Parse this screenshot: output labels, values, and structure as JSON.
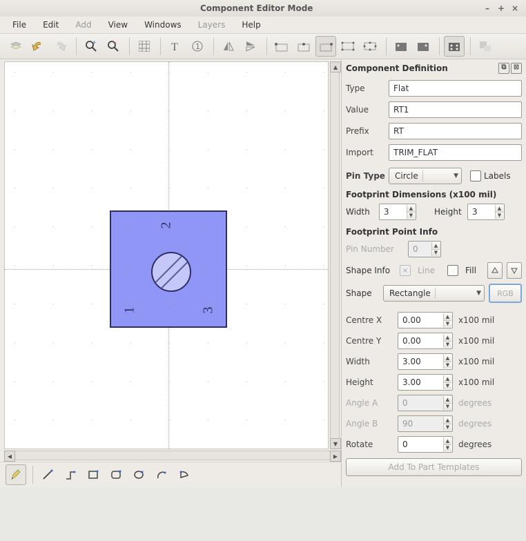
{
  "window": {
    "title": "Component Editor Mode"
  },
  "menu": {
    "file": "File",
    "edit": "Edit",
    "add": "Add",
    "view": "View",
    "windows": "Windows",
    "layers": "Layers",
    "help": "Help"
  },
  "panel": {
    "title": "Component Definition",
    "type_label": "Type",
    "type_value": "Flat",
    "value_label": "Value",
    "value_value": "RT1",
    "prefix_label": "Prefix",
    "prefix_value": "RT",
    "import_label": "Import",
    "import_value": "TRIM_FLAT",
    "pintype_label": "Pin Type",
    "pintype_value": "Circle",
    "labels_label": "Labels",
    "dims_title": "Footprint Dimensions (x100 mil)",
    "dim_width_label": "Width",
    "dim_width_value": "3",
    "dim_height_label": "Height",
    "dim_height_value": "3",
    "pointinfo_title": "Footprint Point Info",
    "pinnum_label": "Pin Number",
    "pinnum_value": "0",
    "shapeinfo_label": "Shape Info",
    "line_label": "Line",
    "fill_label": "Fill",
    "shape_label": "Shape",
    "shape_value": "Rectangle",
    "rgb_label": "RGB",
    "params": {
      "cx": {
        "label": "Centre X",
        "value": "0.00",
        "unit": "x100 mil"
      },
      "cy": {
        "label": "Centre Y",
        "value": "0.00",
        "unit": "x100 mil"
      },
      "w": {
        "label": "Width",
        "value": "3.00",
        "unit": "x100 mil"
      },
      "h": {
        "label": "Height",
        "value": "3.00",
        "unit": "x100 mil"
      },
      "aa": {
        "label": "Angle A",
        "value": "0",
        "unit": "degrees"
      },
      "ab": {
        "label": "Angle B",
        "value": "90",
        "unit": "degrees"
      },
      "rot": {
        "label": "Rotate",
        "value": "0",
        "unit": "degrees"
      }
    },
    "add_button": "Add To Part Templates"
  },
  "canvas": {
    "pins": {
      "p1": "1",
      "p2": "2",
      "p3": "3"
    }
  }
}
